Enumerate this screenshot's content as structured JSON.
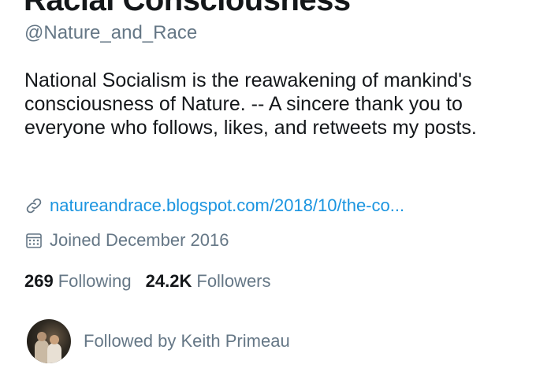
{
  "profile": {
    "display_name": "Racial Consciousness",
    "handle": "@Nature_and_Race",
    "bio": "National Socialism is the reawakening of mankind's consciousness of Nature. -- A sincere thank you to everyone who follows, likes, and retweets my posts.",
    "website": "natureandrace.blogspot.com/2018/10/the-co...",
    "website_icon": "link-icon",
    "joined": "Joined December 2016",
    "joined_icon": "calendar-icon"
  },
  "stats": {
    "following_count": "269",
    "following_label": "Following",
    "followers_count": "24.2K",
    "followers_label": "Followers"
  },
  "followed_by": {
    "text": "Followed by Keith Primeau"
  },
  "colors": {
    "link": "#1b95e0",
    "secondary_text": "#657786",
    "primary_text": "#14171a"
  }
}
